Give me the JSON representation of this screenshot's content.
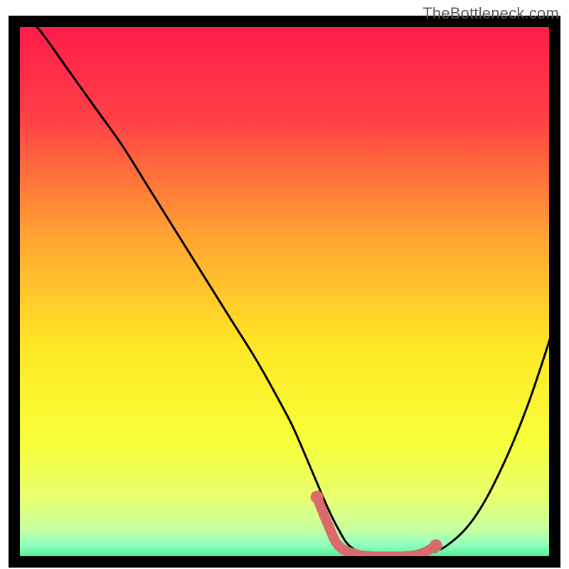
{
  "watermark": "TheBottleneck.com",
  "chart_data": {
    "type": "line",
    "title": "",
    "xlabel": "",
    "ylabel": "",
    "xlim": [
      0,
      100
    ],
    "ylim": [
      0,
      100
    ],
    "series": [
      {
        "name": "bottleneck-curve",
        "x": [
          3,
          5,
          10,
          15,
          20,
          25,
          30,
          35,
          40,
          45,
          50,
          52,
          55,
          58,
          60,
          62,
          65,
          68,
          72,
          76,
          80,
          85,
          90,
          95,
          100
        ],
        "y": [
          100,
          98,
          91,
          84,
          77,
          69,
          61,
          53,
          45,
          37,
          28,
          24,
          17,
          10,
          6,
          3,
          1.5,
          1,
          1,
          1.5,
          3,
          8,
          17,
          29,
          44
        ]
      },
      {
        "name": "highlight-segment",
        "x": [
          56,
          58,
          60,
          63,
          66,
          69,
          72,
          74,
          76,
          78
        ],
        "y": [
          12,
          7,
          3,
          1.5,
          1,
          1,
          1,
          1.2,
          1.8,
          3
        ]
      }
    ],
    "highlight_points": [
      {
        "x": 56,
        "y": 12
      },
      {
        "x": 78,
        "y": 3
      }
    ],
    "background_gradient": {
      "type": "vertical",
      "stops": [
        {
          "offset": 0.0,
          "color": "#ff1a4b"
        },
        {
          "offset": 0.18,
          "color": "#ff4046"
        },
        {
          "offset": 0.4,
          "color": "#ffa531"
        },
        {
          "offset": 0.6,
          "color": "#ffe725"
        },
        {
          "offset": 0.78,
          "color": "#f7ff3a"
        },
        {
          "offset": 0.88,
          "color": "#e8ff6e"
        },
        {
          "offset": 0.94,
          "color": "#c7ffa0"
        },
        {
          "offset": 0.97,
          "color": "#8dffc0"
        },
        {
          "offset": 1.0,
          "color": "#35e67a"
        }
      ]
    },
    "frame_color": "#000000",
    "curve_color": "#000000",
    "highlight_color": "#d96b6b"
  }
}
